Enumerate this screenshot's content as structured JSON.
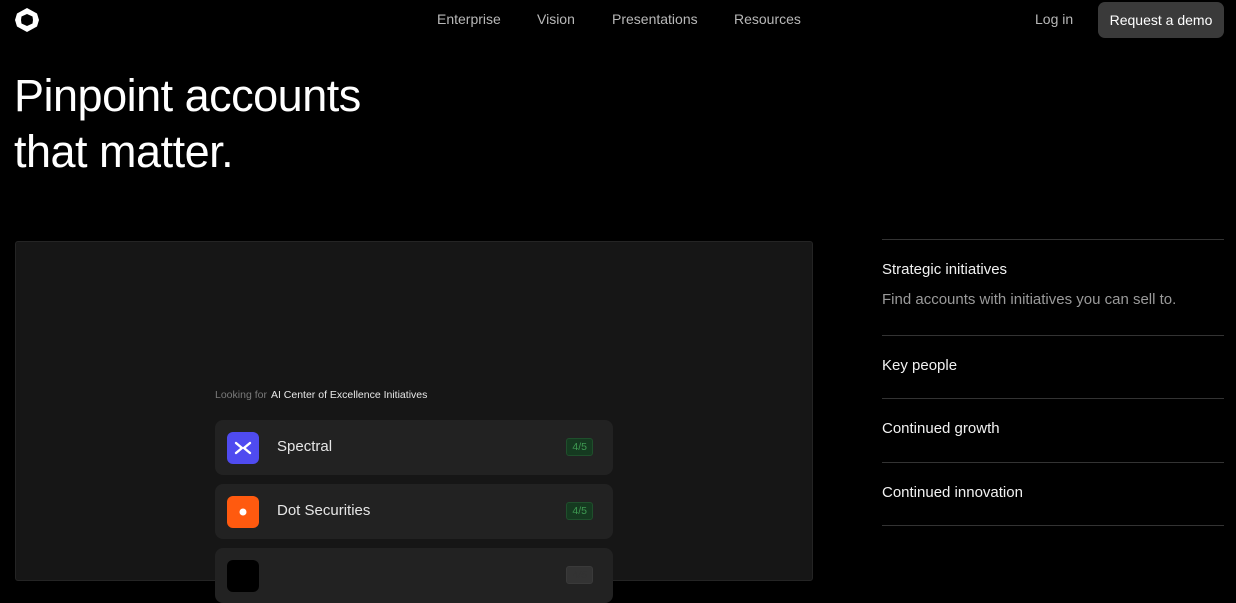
{
  "nav": {
    "links": [
      "Enterprise",
      "Vision",
      "Presentations",
      "Resources"
    ],
    "login": "Log in",
    "demo": "Request a demo"
  },
  "hero": {
    "line1": "Pinpoint accounts",
    "line2": "that matter."
  },
  "panel": {
    "looking_label": "Looking for",
    "looking_value": "AI Center of Excellence Initiatives",
    "cards": [
      {
        "name": "Spectral",
        "score": "4/5",
        "icon": "spectral-logo-icon",
        "color": "#4f4bf0"
      },
      {
        "name": "Dot Securities",
        "score": "4/5",
        "icon": "dot-securities-logo-icon",
        "color": "#ff5a0f"
      },
      {
        "name": "",
        "score": "",
        "icon": "company-logo-icon",
        "color": "#000000"
      }
    ]
  },
  "features": [
    {
      "title": "Strategic initiatives",
      "desc": "Find accounts with initiatives you can sell to."
    },
    {
      "title": "Key people"
    },
    {
      "title": "Continued growth"
    },
    {
      "title": "Continued innovation"
    }
  ]
}
